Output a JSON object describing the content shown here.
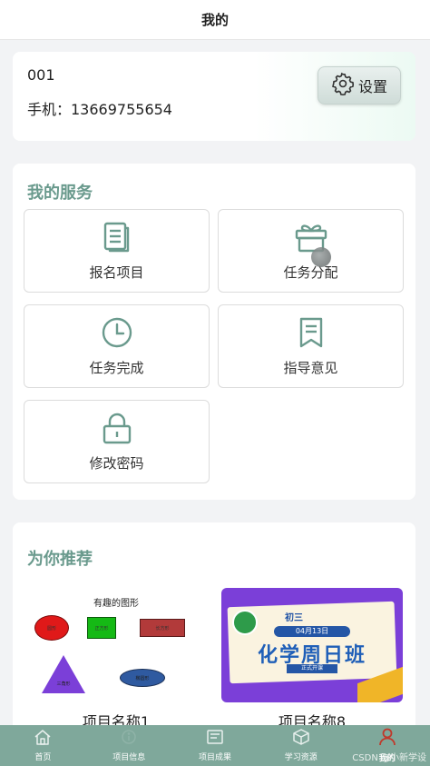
{
  "header": {
    "title": "我的"
  },
  "user": {
    "id": "001",
    "phone_label": "手机：13669755654",
    "settings_label": "设置"
  },
  "services": {
    "title": "我的服务",
    "items": [
      {
        "label": "报名项目",
        "icon": "document-icon"
      },
      {
        "label": "任务分配",
        "icon": "gift-icon"
      },
      {
        "label": "任务完成",
        "icon": "clock-icon"
      },
      {
        "label": "指导意见",
        "icon": "bookmark-icon"
      },
      {
        "label": "修改密码",
        "icon": "lock-icon"
      }
    ]
  },
  "recommend": {
    "title": "为你推荐",
    "items": [
      {
        "name": "项目名称1",
        "image_text": {
          "heading": "有趣的图形",
          "shapes": [
            "圆形",
            "正方形",
            "长方形",
            "三角形",
            "椭圆形"
          ]
        }
      },
      {
        "name": "项目名称8",
        "image_text": {
          "grade": "初三",
          "date": "04月13日",
          "title": "化学周日班",
          "tag": "正式开课"
        }
      }
    ]
  },
  "tabbar": {
    "items": [
      {
        "label": "首页",
        "icon": "home-icon"
      },
      {
        "label": "项目信息",
        "icon": "info-icon"
      },
      {
        "label": "项目成果",
        "icon": "results-icon"
      },
      {
        "label": "学习资源",
        "icon": "cube-icon"
      },
      {
        "label": "我的",
        "icon": "user-icon",
        "active": true
      }
    ]
  },
  "watermark": "CSDN @小新学设",
  "colors": {
    "accent": "#6a9a8d",
    "tabbar": "#7fa89b",
    "active_tab_icon": "#c0392b",
    "card_banner": "#7b3fd8"
  }
}
